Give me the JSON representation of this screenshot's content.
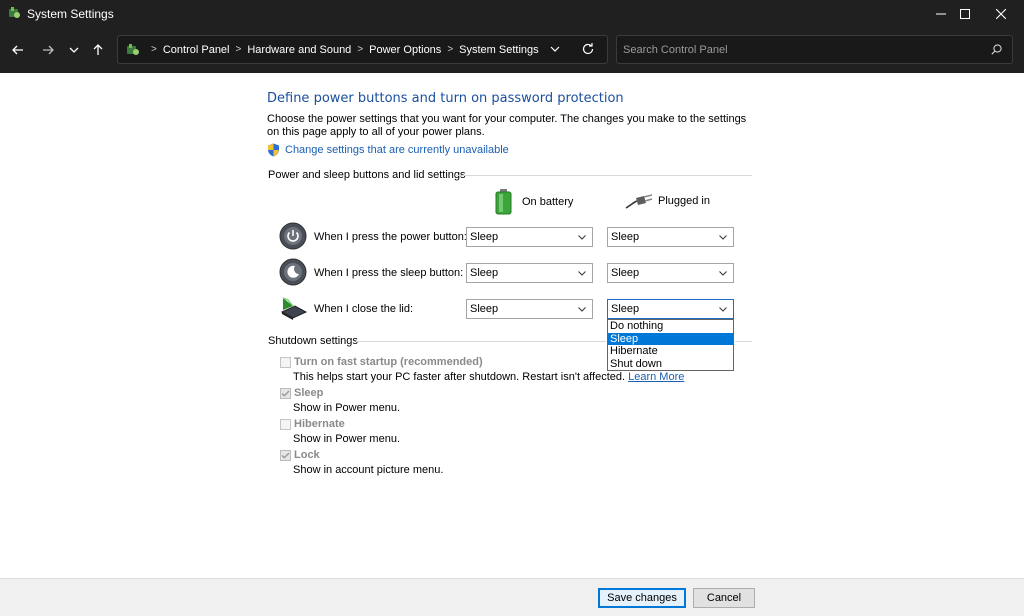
{
  "window": {
    "title": "System Settings"
  },
  "address": {
    "crumbs": [
      "Control Panel",
      "Hardware and Sound",
      "Power Options",
      "System Settings"
    ],
    "search_placeholder": "Search Control Panel"
  },
  "page": {
    "title": "Define power buttons and turn on password protection",
    "intro": "Choose the power settings that you want for your computer. The changes you make to the settings on this page apply to all of your power plans.",
    "change_link": "Change settings that are currently unavailable"
  },
  "buttons_section": {
    "label": "Power and sleep buttons and lid settings",
    "col_battery": "On battery",
    "col_plugged": "Plugged in",
    "rows": [
      {
        "label": "When I press the power button:",
        "battery": "Sleep",
        "plugged": "Sleep"
      },
      {
        "label": "When I press the sleep button:",
        "battery": "Sleep",
        "plugged": "Sleep"
      },
      {
        "label": "When I close the lid:",
        "battery": "Sleep",
        "plugged": "Sleep"
      }
    ],
    "dropdown_options": [
      "Do nothing",
      "Sleep",
      "Hibernate",
      "Shut down"
    ],
    "dropdown_selected": "Sleep"
  },
  "shutdown": {
    "label": "Shutdown settings",
    "items": [
      {
        "title": "Turn on fast startup (recommended)",
        "desc": "This helps start your PC faster after shutdown. Restart isn't affected.",
        "link": "Learn More",
        "checked": false
      },
      {
        "title": "Sleep",
        "desc": "Show in Power menu.",
        "checked": true
      },
      {
        "title": "Hibernate",
        "desc": "Show in Power menu.",
        "checked": false
      },
      {
        "title": "Lock",
        "desc": "Show in account picture menu.",
        "checked": true
      }
    ]
  },
  "footer": {
    "save": "Save changes",
    "cancel": "Cancel"
  },
  "colors": {
    "titlebar": "#202020",
    "link": "#1a5fb4",
    "title": "#1b4f9c",
    "selection": "#0078d7"
  }
}
